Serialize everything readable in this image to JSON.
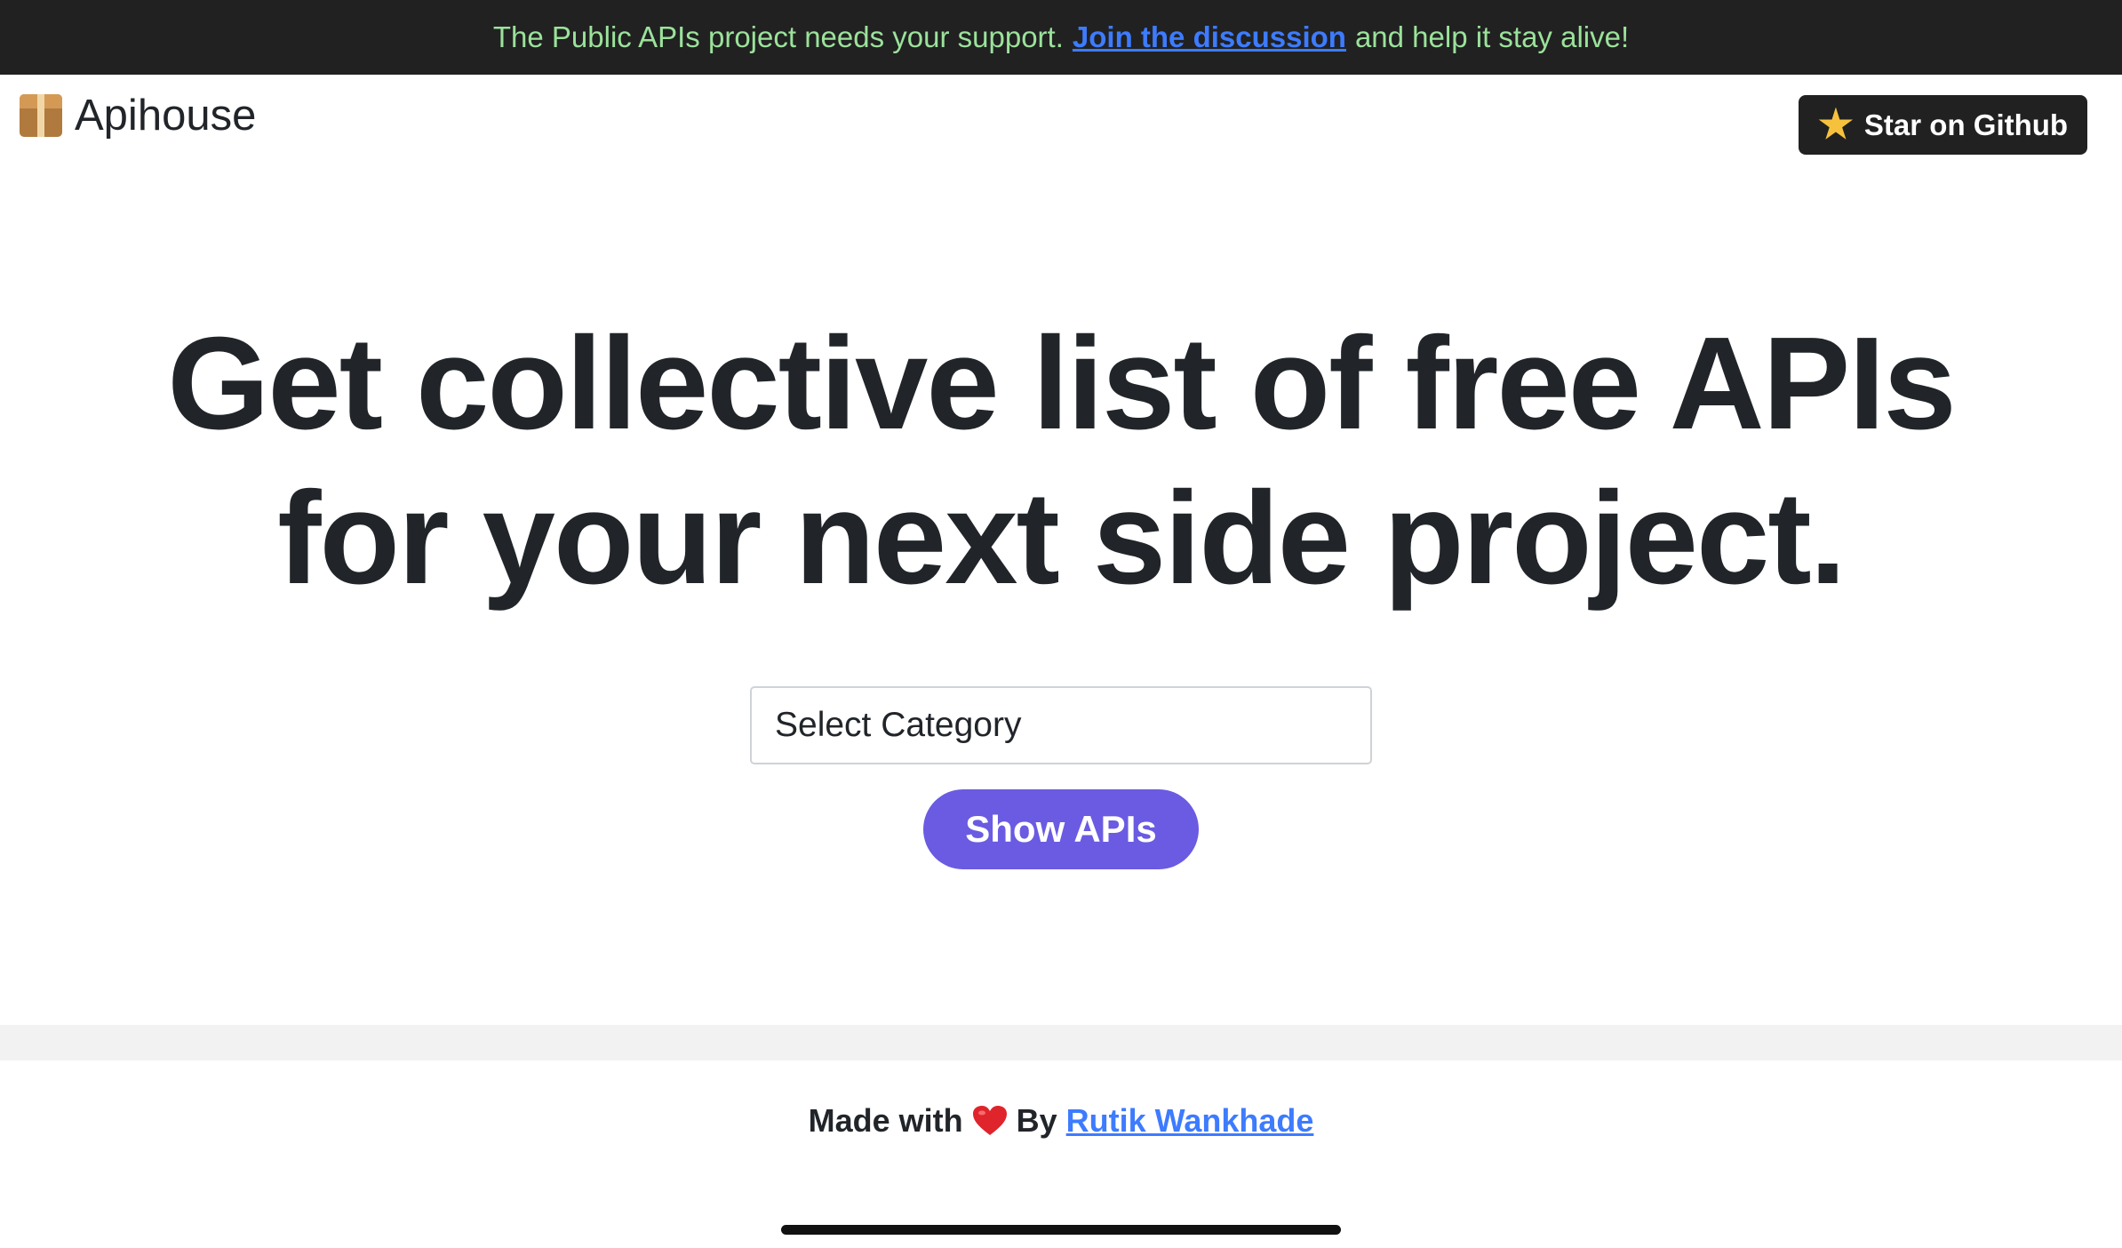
{
  "banner": {
    "text_before": "The Public APIs project needs your support.",
    "link_text": "Join the discussion",
    "text_after": "and help it stay alive!"
  },
  "header": {
    "brand_icon": "package-icon",
    "brand_name": "Apihouse",
    "star_icon": "star-icon",
    "star_button_label": "Star on Github"
  },
  "hero": {
    "line1": "Get collective list of free APIs",
    "line2": "for your next side project."
  },
  "form": {
    "category_select_value": "Select Category",
    "show_button_label": "Show APIs"
  },
  "footer": {
    "made_with": "Made with",
    "heart_icon": "heart-icon",
    "by": "By",
    "author_link": "Rutik Wankhade"
  },
  "colors": {
    "banner_bg": "#212121",
    "banner_text": "#9be29b",
    "link": "#3d7bff",
    "primary_button": "#6a5be2",
    "text": "#212529"
  }
}
